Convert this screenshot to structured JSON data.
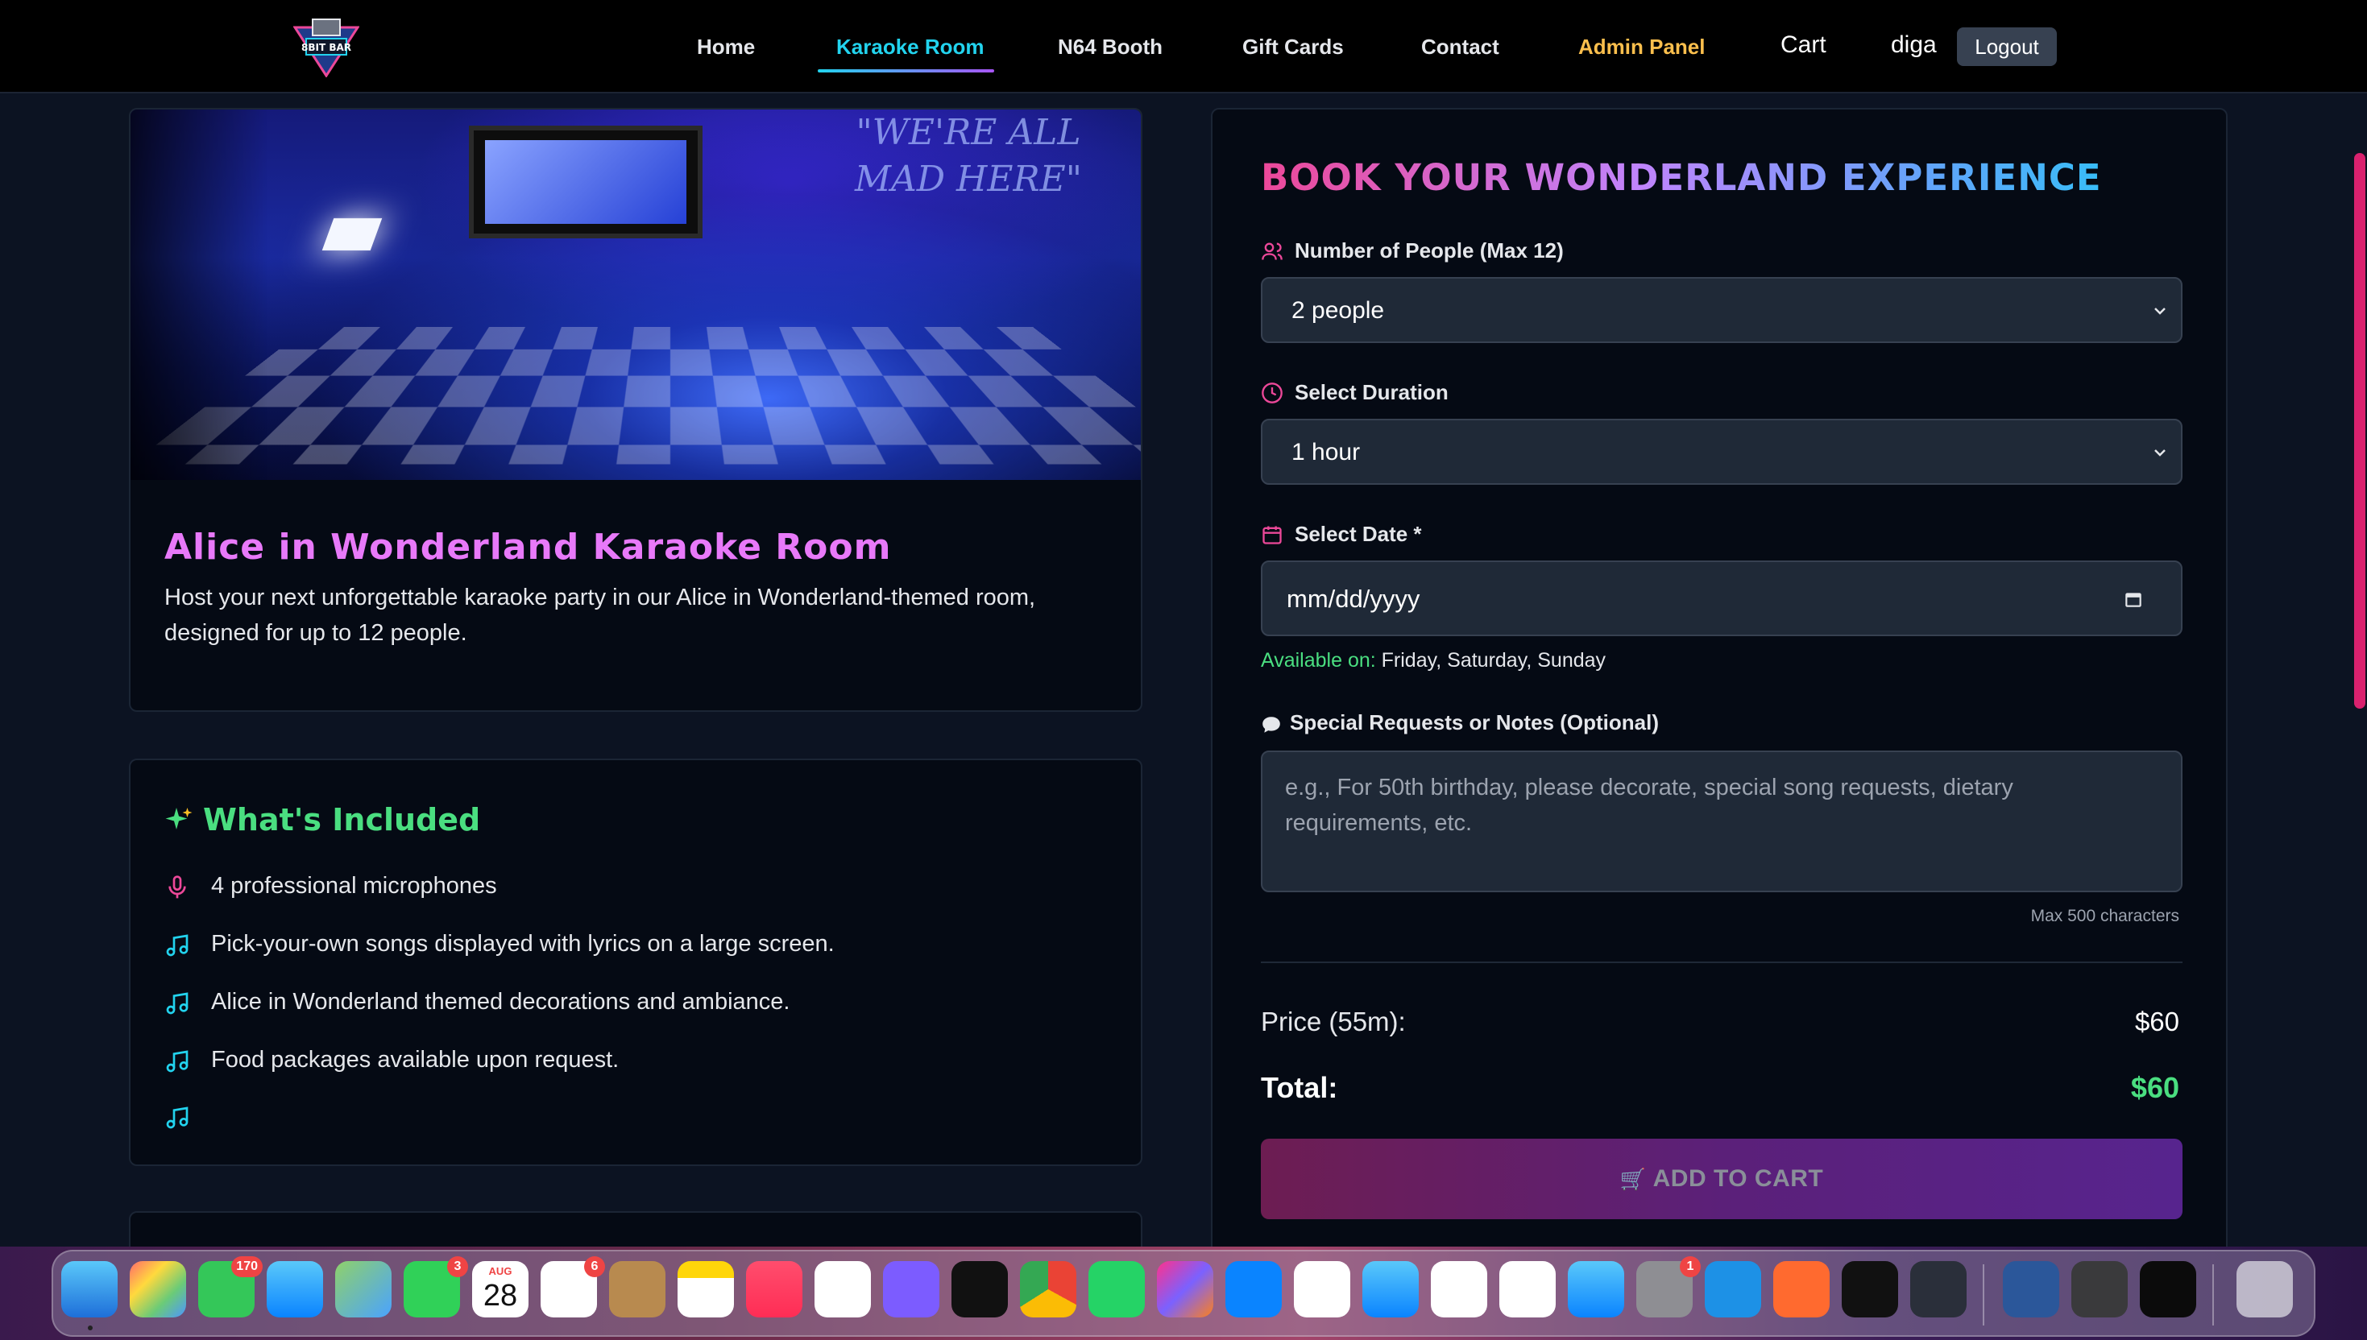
{
  "nav": {
    "items": [
      {
        "label": "Home"
      },
      {
        "label": "Karaoke Room"
      },
      {
        "label": "N64 Booth"
      },
      {
        "label": "Gift Cards"
      },
      {
        "label": "Contact"
      },
      {
        "label": "Admin Panel"
      }
    ],
    "active": "Karaoke Room",
    "cart_label": "Cart",
    "username": "diga",
    "logout_label": "Logout",
    "logo_text": "8BIT BAR"
  },
  "room": {
    "wall_text": "\"WE'RE ALL MAD HERE\"",
    "title": "Alice in Wonderland Karaoke Room",
    "description": "Host your next unforgettable karaoke party in our Alice in Wonderland-themed room, designed for up to 12 people."
  },
  "included": {
    "title": "What's Included",
    "items": [
      {
        "icon": "microphone-icon",
        "text": "4 professional microphones"
      },
      {
        "icon": "music-note-icon",
        "text": "Pick-your-own songs displayed with lyrics on a large screen."
      },
      {
        "icon": "music-note-icon",
        "text": "Alice in Wonderland themed decorations and ambiance."
      },
      {
        "icon": "music-note-icon",
        "text": "Food packages available upon request."
      },
      {
        "icon": "music-note-icon",
        "text": ""
      }
    ]
  },
  "booking": {
    "title": "BOOK YOUR WONDERLAND EXPERIENCE",
    "people_label": "Number of People (Max 12)",
    "people_value": "2 people",
    "duration_label": "Select Duration",
    "duration_value": "1 hour",
    "date_label": "Select Date *",
    "date_placeholder": "mm/dd/yyyy",
    "available_label": "Available on:",
    "available_days": "Friday, Saturday, Sunday",
    "notes_label": "Special Requests or Notes (Optional)",
    "notes_placeholder": "e.g., For 50th birthday, please decorate, special song requests, dietary requirements, etc.",
    "max_chars": "Max 500 characters",
    "price_label": "Price (55m):",
    "price_value": "$60",
    "total_label": "Total:",
    "total_value": "$60",
    "add_to_cart_label": "ADD TO CART"
  },
  "dock": {
    "messages_badge": "170",
    "facetime_badge": "3",
    "reminders_badge": "6",
    "settings_badge": "1",
    "calendar_month": "AUG",
    "calendar_day": "28"
  },
  "colors": {
    "accent_cyan": "#22d3ee",
    "accent_pink": "#e879f9",
    "accent_green": "#4ade80",
    "admin_orange": "#fbbf4d"
  }
}
